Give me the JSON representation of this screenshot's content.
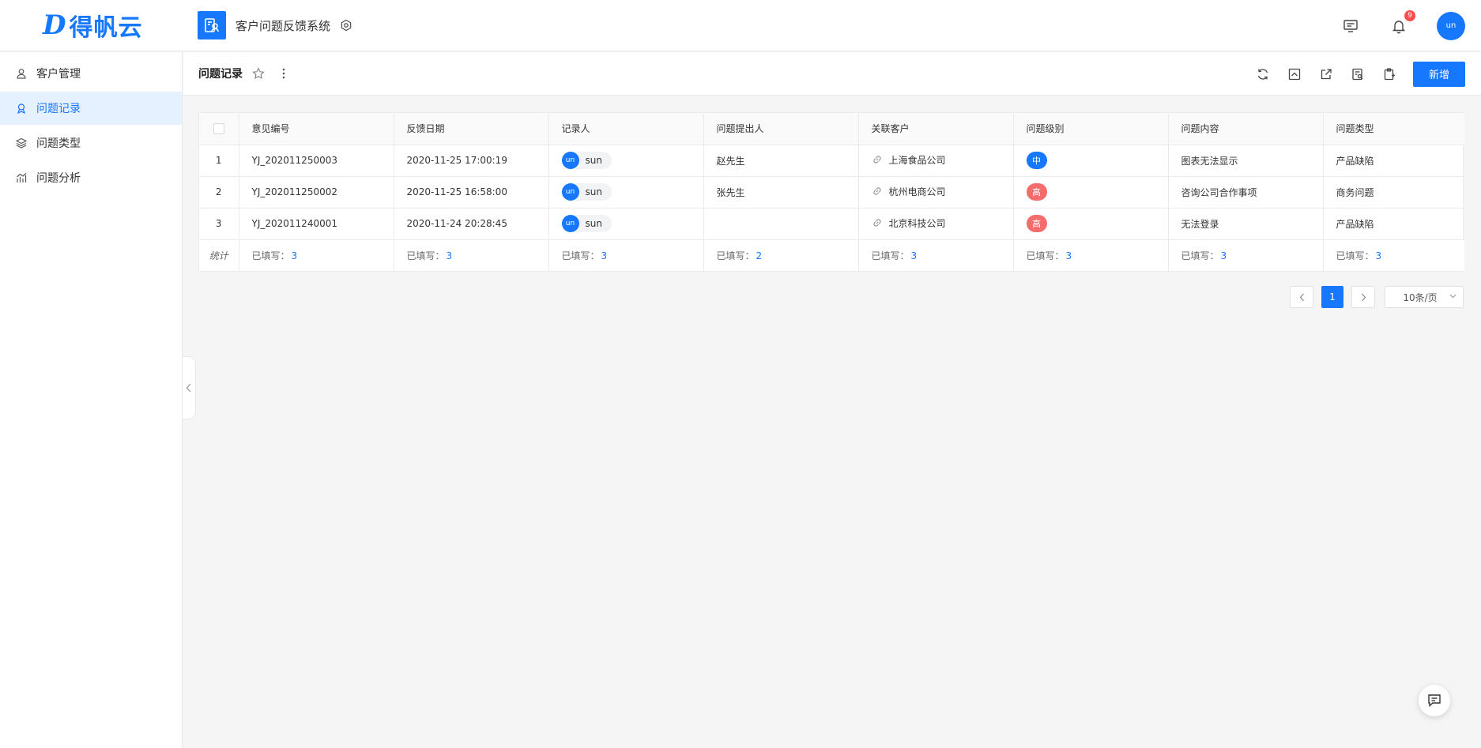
{
  "header": {
    "logo_text": "得帆云",
    "app_title": "客户问题反馈系统",
    "notification_count": "9",
    "user_initials": "un"
  },
  "sidebar": {
    "items": [
      {
        "label": "客户管理",
        "icon": "user-icon",
        "active": false
      },
      {
        "label": "问题记录",
        "icon": "feedback-icon",
        "active": true
      },
      {
        "label": "问题类型",
        "icon": "layers-icon",
        "active": false
      },
      {
        "label": "问题分析",
        "icon": "chart-icon",
        "active": false
      }
    ]
  },
  "toolbar": {
    "title": "问题记录",
    "add_label": "新增"
  },
  "table": {
    "columns": [
      "意见编号",
      "反馈日期",
      "记录人",
      "问题提出人",
      "关联客户",
      "问题级别",
      "问题内容",
      "问题类型"
    ],
    "rows": [
      {
        "index": "1",
        "id": "YJ_202011250003",
        "date": "2020-11-25 17:00:19",
        "recorder_initials": "un",
        "recorder": "sun",
        "proposer": "赵先生",
        "customer": "上海食品公司",
        "level": "中",
        "level_color": "#1677ff",
        "content": "图表无法显示",
        "type": "产品缺陷"
      },
      {
        "index": "2",
        "id": "YJ_202011250002",
        "date": "2020-11-25 16:58:00",
        "recorder_initials": "un",
        "recorder": "sun",
        "proposer": "张先生",
        "customer": "杭州电商公司",
        "level": "高",
        "level_color": "#f56c6c",
        "content": "咨询公司合作事项",
        "type": "商务问题"
      },
      {
        "index": "3",
        "id": "YJ_202011240001",
        "date": "2020-11-24 20:28:45",
        "recorder_initials": "un",
        "recorder": "sun",
        "proposer": "",
        "customer": "北京科技公司",
        "level": "高",
        "level_color": "#f56c6c",
        "content": "无法登录",
        "type": "产品缺陷"
      }
    ],
    "stats": {
      "label": "统计",
      "prefix": "已填写：",
      "values": [
        "3",
        "3",
        "3",
        "2",
        "3",
        "3",
        "3",
        "3"
      ]
    }
  },
  "pagination": {
    "current_page": "1",
    "page_size": "10条/页"
  },
  "colors": {
    "primary": "#1677ff",
    "danger": "#f56c6c"
  }
}
